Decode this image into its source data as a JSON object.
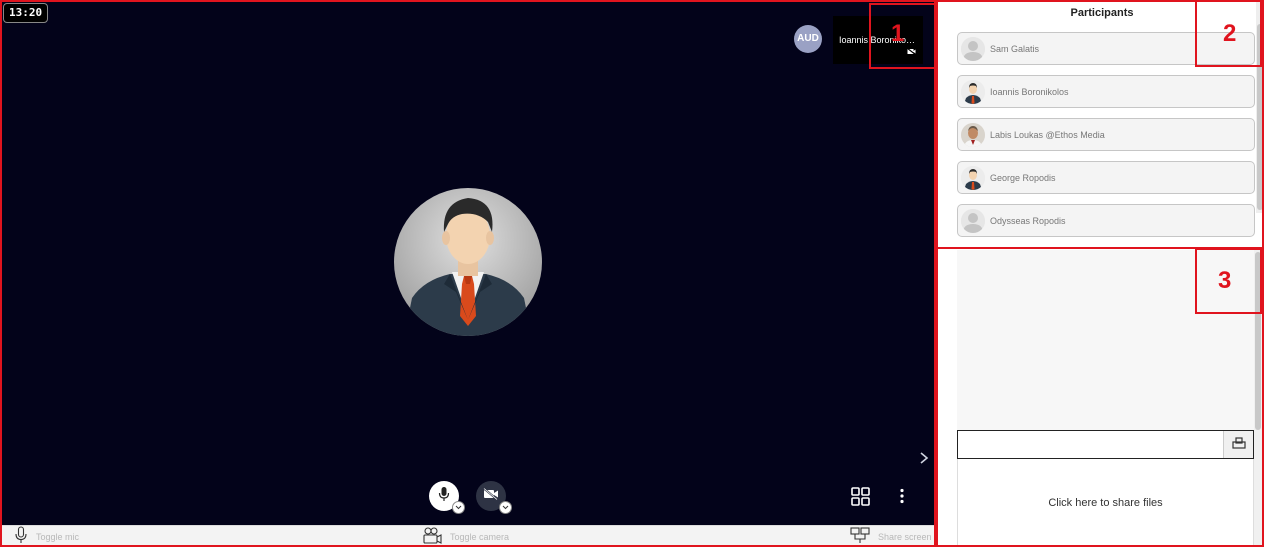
{
  "clock": "13:20",
  "remote": {
    "aud_initials": "AUD",
    "tile_name": "Ioannis Boronikolos"
  },
  "toolbar": {
    "mic_label": "Toggle mic",
    "camera_label": "Toggle camera",
    "share_label": "Share screen"
  },
  "participants": {
    "title": "Participants",
    "items": [
      {
        "name": "Sam Galatis",
        "avatar": "default-avatar-icon"
      },
      {
        "name": "Ioannis Boronikolos",
        "avatar": "businessman-avatar"
      },
      {
        "name": "Labis Loukas @Ethos Media",
        "avatar": "photo-avatar"
      },
      {
        "name": "George Ropodis",
        "avatar": "businessman-avatar"
      },
      {
        "name": "Odysseas Ropodis",
        "avatar": "default-avatar-icon"
      }
    ]
  },
  "chat": {
    "input_value": "",
    "share_files_label": "Click here to share files"
  },
  "annotations": [
    "1",
    "2",
    "3"
  ],
  "colors": {
    "stage_bg": "#03031a",
    "annotation": "#e0141e",
    "aud_avatar": "#9aa1c4"
  }
}
